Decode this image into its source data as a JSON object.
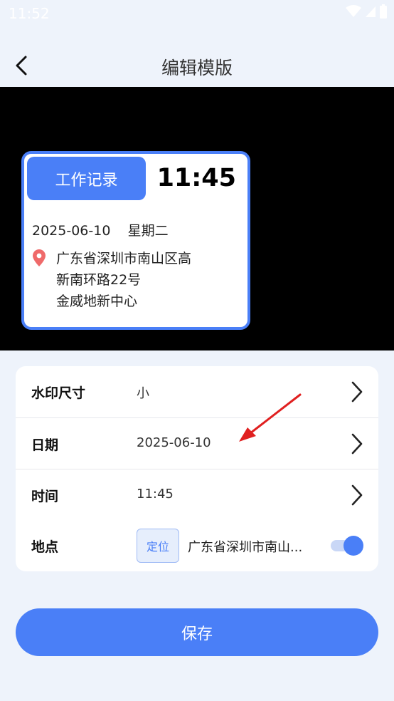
{
  "status_bar": {
    "time": "11:52"
  },
  "header": {
    "title": "编辑模版"
  },
  "preview": {
    "badge": "工作记录",
    "time": "11:45",
    "date_line": "2025-06-10    星期二",
    "address_lines": [
      "广东省深圳市南山区高",
      "新南环路22号",
      "金威地新中心"
    ]
  },
  "settings": {
    "size": {
      "label": "水印尺寸",
      "value": "小"
    },
    "date": {
      "label": "日期",
      "value": "2025-06-10"
    },
    "time": {
      "label": "时间",
      "value": "11:45"
    },
    "location": {
      "label": "地点",
      "locate_button": "定位",
      "value": "广东省深圳市南山...",
      "toggle_on": true
    }
  },
  "save_button": "保存",
  "colors": {
    "accent": "#4a7ff7",
    "annotation_arrow": "#e02020"
  },
  "icons": [
    "back-arrow-icon",
    "map-pin-icon",
    "chevron-right-icon",
    "wifi-icon",
    "signal-icon",
    "battery-icon"
  ]
}
